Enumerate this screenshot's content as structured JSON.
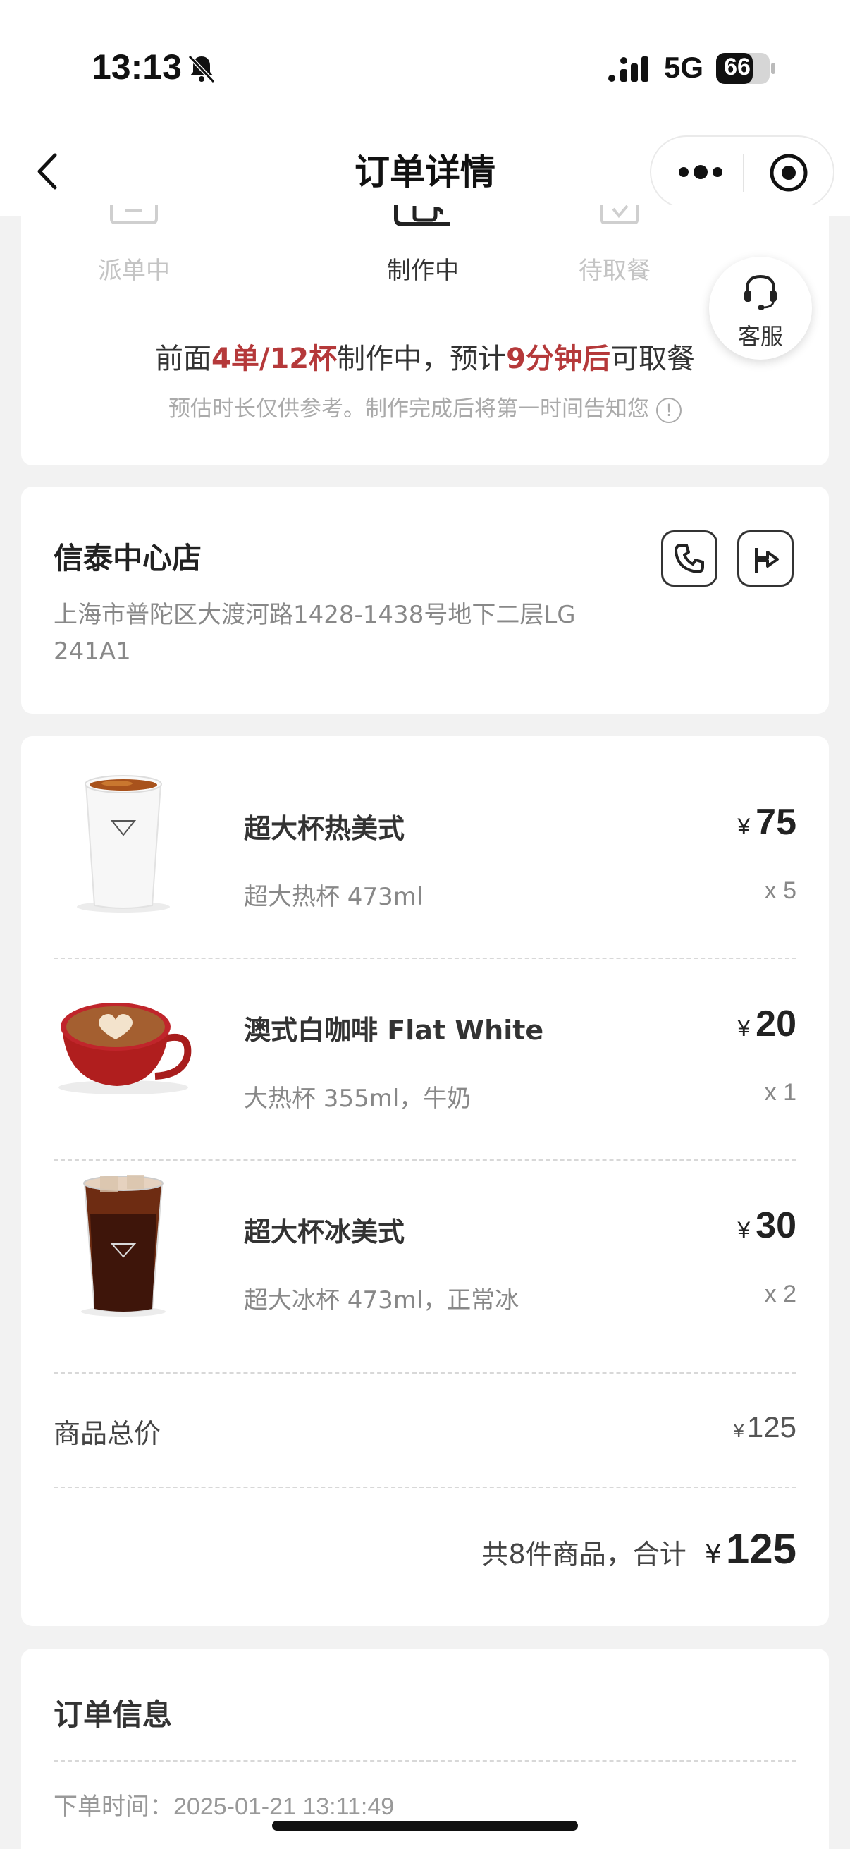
{
  "status_bar": {
    "time": "13:13",
    "network": "5G",
    "battery": "66"
  },
  "nav": {
    "title": "订单详情"
  },
  "progress": {
    "steps": [
      {
        "label": "派单中",
        "state": "done"
      },
      {
        "label": "制作中",
        "state": "active"
      },
      {
        "label": "待取餐",
        "state": "pending"
      }
    ],
    "message_prefix": "前面",
    "queue_count": "4单/12杯",
    "message_mid": "制作中，预计",
    "eta": "9分钟后",
    "message_suffix": "可取餐",
    "note": "预估时长仅供参考。制作完成后将第一时间告知您"
  },
  "service": {
    "label": "客服"
  },
  "store": {
    "name": "信泰中心店",
    "address": "上海市普陀区大渡河路1428-1438号地下二层LG 241A1"
  },
  "items": [
    {
      "name": "超大杯热美式",
      "spec": "超大热杯 473ml",
      "price": "75",
      "qty": "x 5",
      "image": "hot-americano-cup"
    },
    {
      "name": "澳式白咖啡 Flat White",
      "spec": "大热杯 355ml，牛奶",
      "price": "20",
      "qty": "x 1",
      "image": "flat-white-red-cup"
    },
    {
      "name": "超大杯冰美式",
      "spec": "超大冰杯 473ml，正常冰",
      "price": "30",
      "qty": "x 2",
      "image": "iced-americano-cup"
    }
  ],
  "currency": "¥",
  "subtotal": {
    "label": "商品总价",
    "value": "125"
  },
  "total": {
    "text": "共8件商品，合计",
    "value": "125"
  },
  "order_info": {
    "title": "订单信息",
    "time_label": "下单时间：",
    "time_value": "2025-01-21 13:11:49"
  },
  "colors": {
    "highlight": "#b5393a",
    "background": "#f2f2f2"
  }
}
